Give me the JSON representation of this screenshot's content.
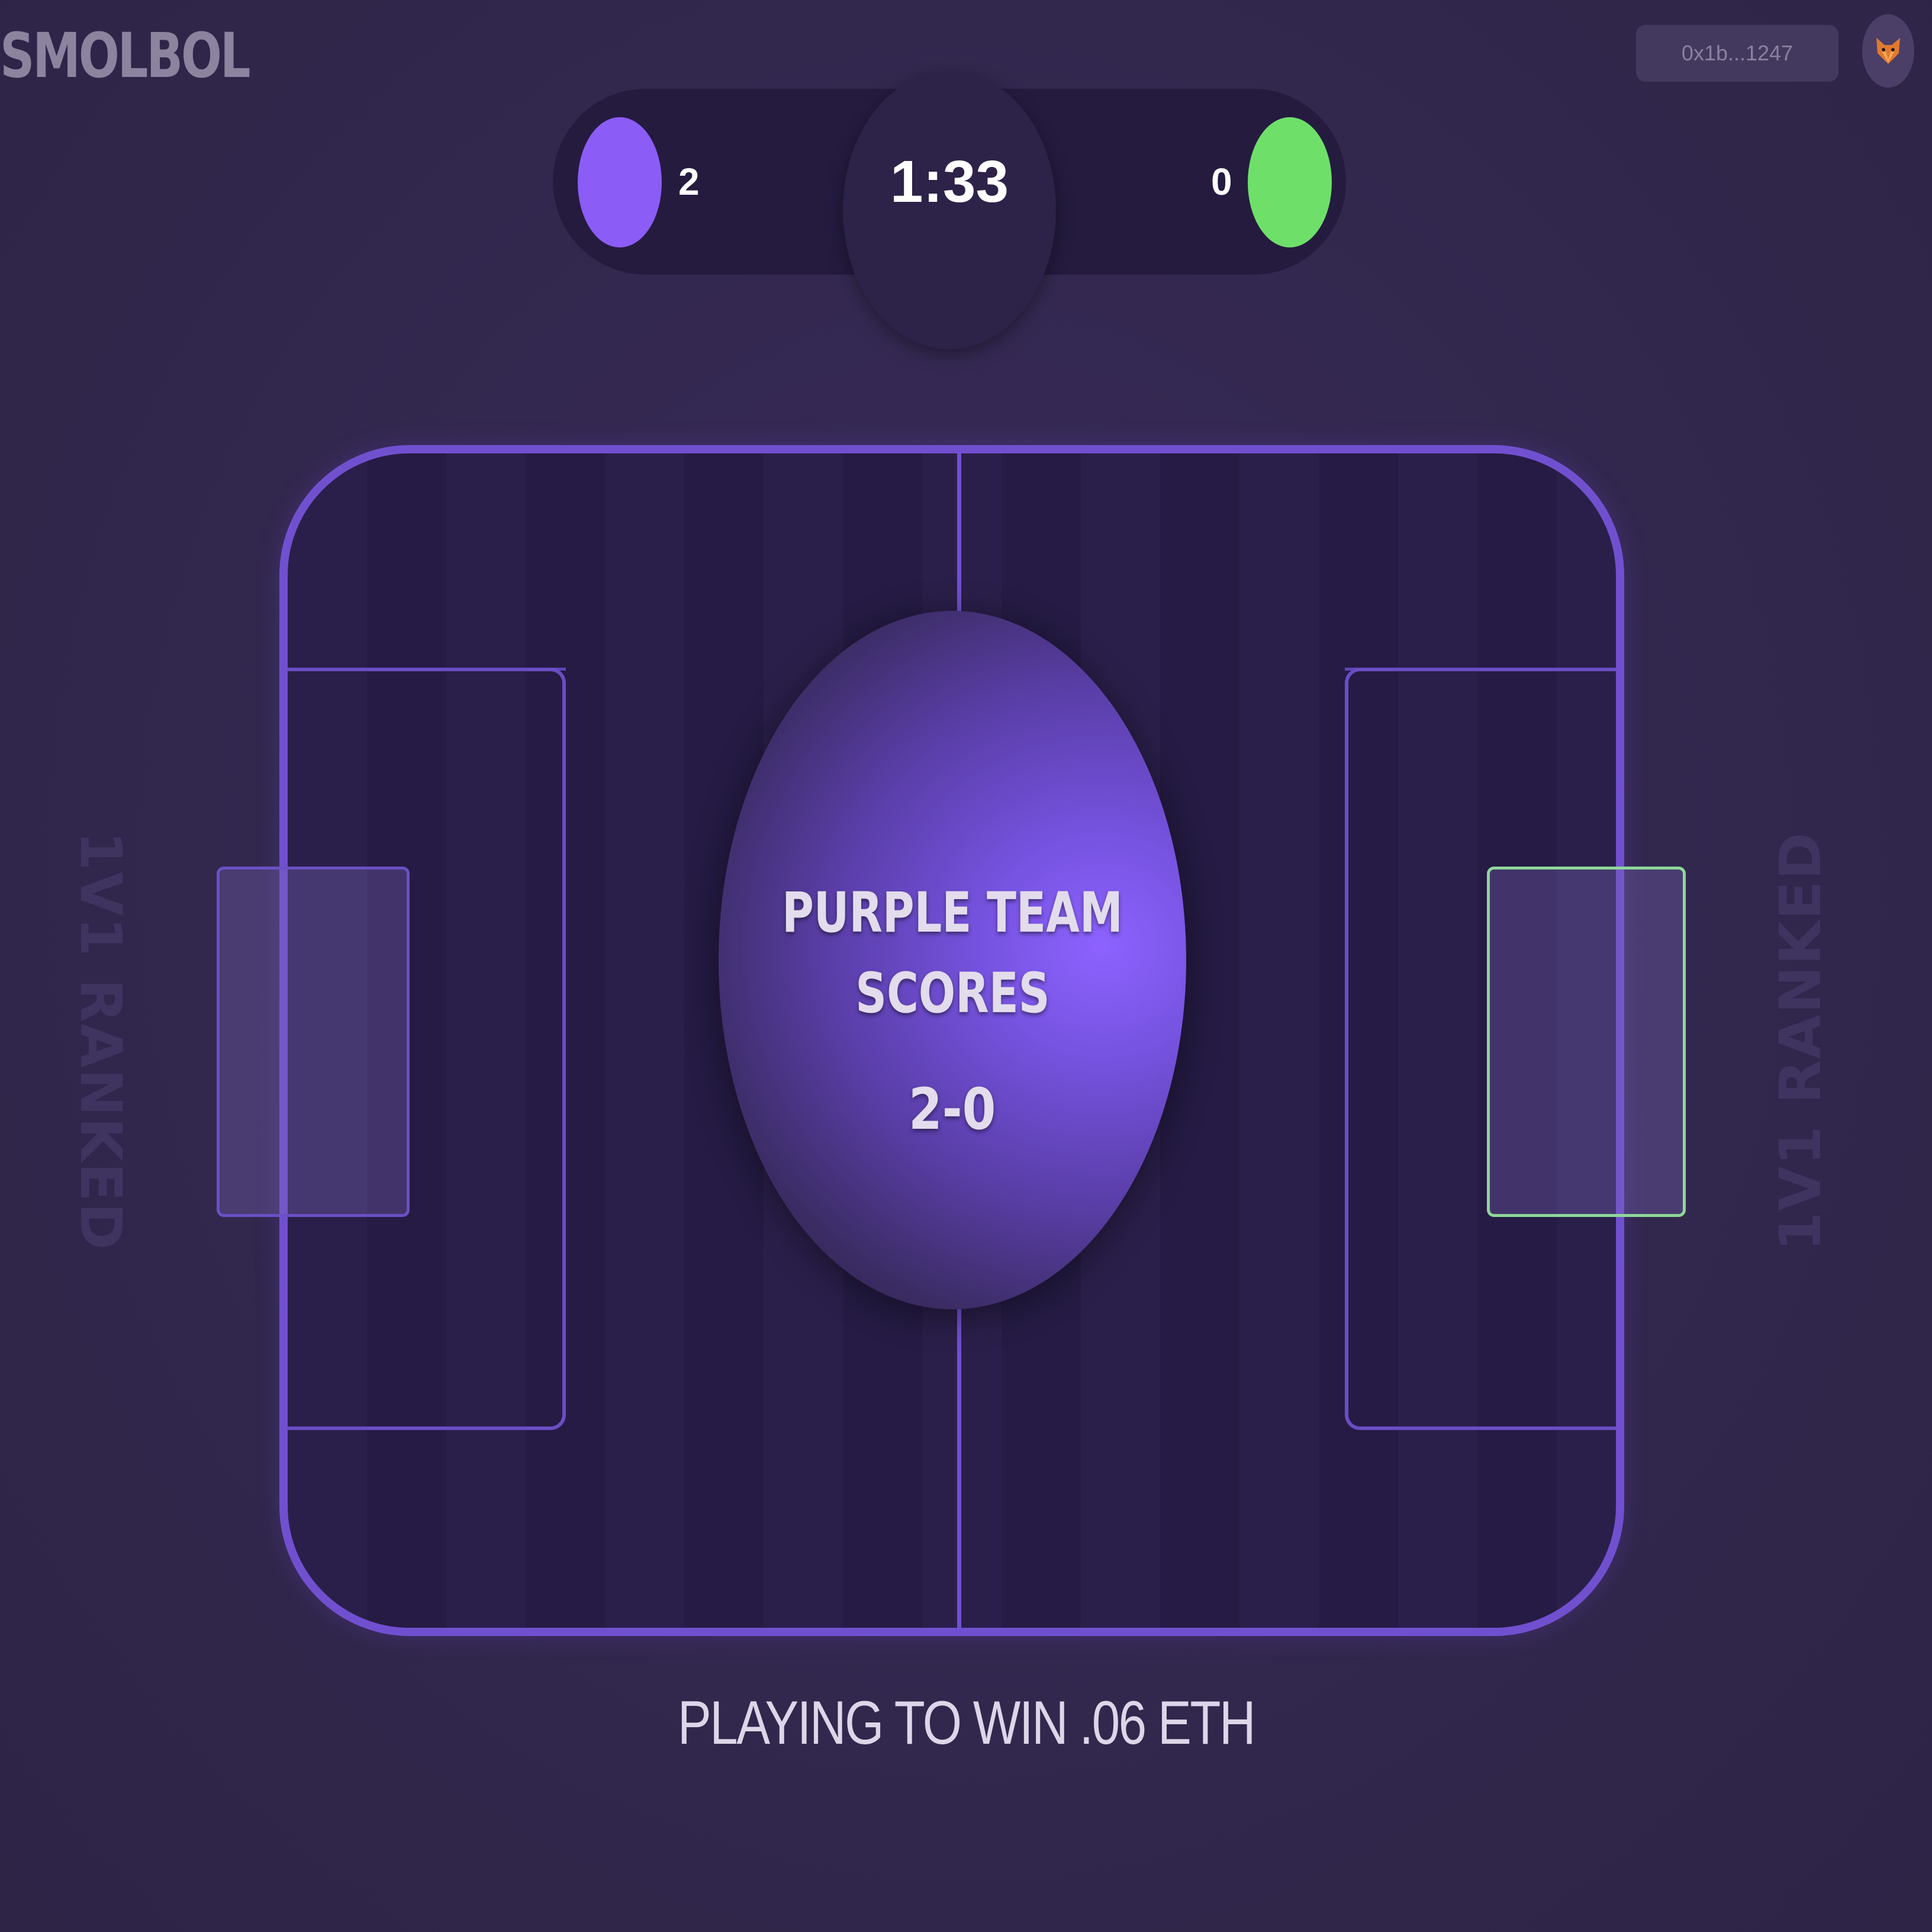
{
  "app": {
    "logo": "SMOLBOL"
  },
  "header": {
    "wallet_address": "0x1b...1247",
    "avatar_icon": "fox-avatar-icon"
  },
  "scoreboard": {
    "timer": "1:33",
    "left_team": {
      "score": "2",
      "color": "#8b5cf6"
    },
    "right_team": {
      "score": "0",
      "color": "#6ee06a"
    }
  },
  "side_labels": {
    "left": "1V1 RANKED",
    "right": "1V1 RANKED"
  },
  "goal_message": {
    "line1": "PURPLE TEAM",
    "line2": "SCORES",
    "score": "2-0"
  },
  "footer": {
    "prize_text": "PLAYING TO WIN .06 ETH"
  },
  "colors": {
    "pitch_line": "#7150d0",
    "right_goal_outline": "#8fd69a"
  }
}
